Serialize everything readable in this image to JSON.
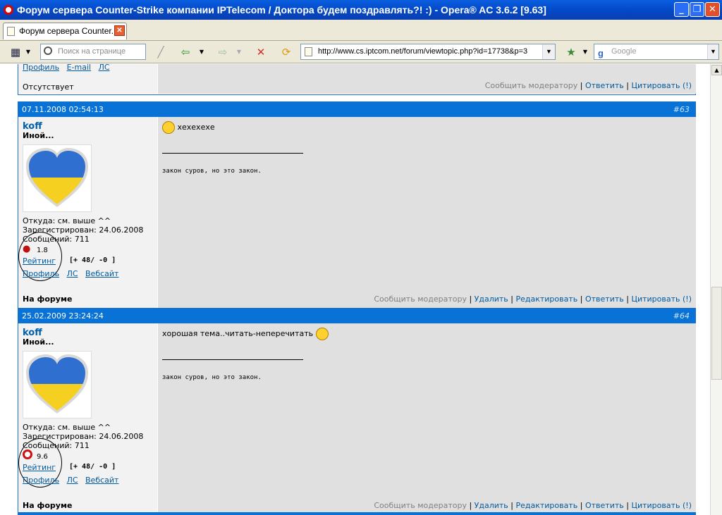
{
  "window": {
    "title": "Форум сервера Counter-Strike компании IPTelecom / Доктора будем поздравлять?! :) - Opera® AC 3.6.2 [9.63]",
    "minimize": "_",
    "maximize": "❐",
    "close": "✕"
  },
  "tab": {
    "label": "Форум сервера Counter...",
    "close": "✕"
  },
  "toolbar": {
    "find_placeholder": "Поиск на странице",
    "url": "http://www.cs.iptcom.net/forum/viewtopic.php?id=17738&p=3",
    "search_placeholder": "Google",
    "search_engine_letter": "g"
  },
  "prev_post": {
    "links": [
      "Профиль",
      "E-mail",
      "ЛС"
    ],
    "status": "Отсутствует",
    "report": "Сообщить модератору",
    "reply": "Ответить",
    "quote": "Цитировать (!)"
  },
  "posts": [
    {
      "date": "07.11.2008 02:54:13",
      "number": "#63",
      "username": "koff",
      "user_title": "Иной...",
      "from": "Откуда: см. выше ^^",
      "registered": "Зарегистрирован: 24.06.2008",
      "messages": "Сообщений: 711",
      "browser_version": "1.8",
      "rating_label": "Рейтинг",
      "rating_value": "[+ 48/ -0 ]",
      "links": [
        "Профиль",
        "ЛС",
        "Вебсайт"
      ],
      "status": "На форуме",
      "text": "хехехехе",
      "signature": "закон суров, но это закон.",
      "actions": {
        "report": "Сообщить модератору",
        "delete": "Удалить",
        "edit": "Редактировать",
        "reply": "Ответить",
        "quote": "Цитировать (!)"
      }
    },
    {
      "date": "25.02.2009 23:24:24",
      "number": "#64",
      "username": "koff",
      "user_title": "Иной...",
      "from": "Откуда: см. выше ^^",
      "registered": "Зарегистрирован: 24.06.2008",
      "messages": "Сообщений: 711",
      "browser_version": "9.6",
      "rating_label": "Рейтинг",
      "rating_value": "[+ 48/ -0 ]",
      "links": [
        "Профиль",
        "ЛС",
        "Вебсайт"
      ],
      "status": "На форуме",
      "text": "хорошая тема..читать-неперечитать",
      "signature": "закон суров, но это закон.",
      "actions": {
        "report": "Сообщить модератору",
        "delete": "Удалить",
        "edit": "Редактировать",
        "reply": "Ответить",
        "quote": "Цитировать (!)"
      }
    }
  ],
  "colors": {
    "post_header": "#0872d6",
    "link": "#005aa0",
    "title_bar": "#0349c8"
  }
}
